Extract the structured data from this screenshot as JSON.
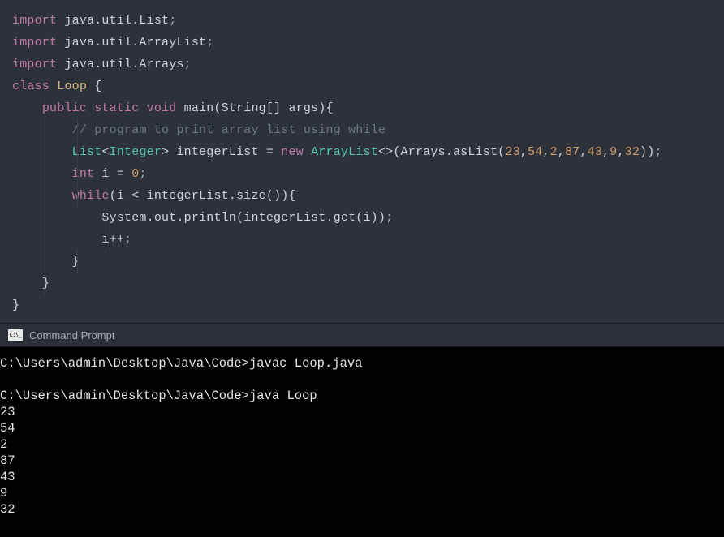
{
  "code": {
    "l1_kw": "import",
    "l1_rest": " java.util.List",
    "l1_semi": ";",
    "l2_kw": "import",
    "l2_rest": " java.util.ArrayList",
    "l2_semi": ";",
    "l3_kw": "import",
    "l3_rest": " java.util.Arrays",
    "l3_semi": ";",
    "l4_kw": "class",
    "l4_name": " Loop ",
    "l4_brace": "{",
    "l5_pad": "    ",
    "l5_public": "public",
    "l5_sp1": " ",
    "l5_static": "static",
    "l5_sp2": " ",
    "l5_void": "void",
    "l5_main": " main(String[] args){",
    "l6_pad": "        ",
    "l6_comment": "// program to print array list using while",
    "l7_pad": "        ",
    "l7_List": "List",
    "l7_gen1": "<",
    "l7_Integer": "Integer",
    "l7_gen2": "> ",
    "l7_var": "integerList = ",
    "l7_new": "new",
    "l7_sp": " ",
    "l7_AL": "ArrayList",
    "l7_ctor": "<>(Arrays.asList(",
    "l7_n1": "23",
    "l7_c1": ",",
    "l7_n2": "54",
    "l7_c2": ",",
    "l7_n3": "2",
    "l7_c3": ",",
    "l7_n4": "87",
    "l7_c4": ",",
    "l7_n5": "43",
    "l7_c5": ",",
    "l7_n6": "9",
    "l7_c6": ",",
    "l7_n7": "32",
    "l7_end": "))",
    "l7_semi": ";",
    "l8_pad": "        ",
    "l8_int": "int",
    "l8_ieq": " i = ",
    "l8_zero": "0",
    "l8_semi": ";",
    "l9_pad": "        ",
    "l9_while": "while",
    "l9_cond": "(i < integerList.size()){",
    "l10_pad": "            ",
    "l10_body": "System.out.println(integerList.get(i))",
    "l10_semi": ";",
    "l11_pad": "            ",
    "l11_body": "i++",
    "l11_semi": ";",
    "l12_pad": "        ",
    "l12_brace": "}",
    "l13_pad": "    ",
    "l13_brace": "}",
    "l14_brace": "}"
  },
  "terminal": {
    "title": "Command Prompt",
    "prompt": "C:\\Users\\admin\\Desktop\\Java\\Code>",
    "cmd1": "javac Loop.java",
    "cmd2": "java Loop",
    "out": [
      "23",
      "54",
      "2",
      "87",
      "43",
      "9",
      "32"
    ]
  }
}
